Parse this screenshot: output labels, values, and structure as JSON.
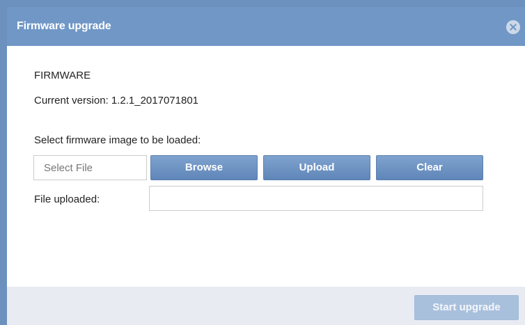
{
  "dialog": {
    "title": "Firmware upgrade",
    "close_icon": "close-circle-icon"
  },
  "firmware": {
    "section_title": "FIRMWARE",
    "current_version": "Current version: 1.2.1_2017071801"
  },
  "upload": {
    "select_label": "Select firmware image to be loaded:",
    "file_placeholder": "Select File",
    "browse_label": "Browse",
    "upload_label": "Upload",
    "clear_label": "Clear",
    "uploaded_label": "File uploaded:",
    "uploaded_value": ""
  },
  "footer": {
    "start_label": "Start upgrade",
    "start_enabled": false
  },
  "colors": {
    "titlebar": "#7097c6",
    "button": "#6d93c4",
    "button_disabled": "#a9c0dd",
    "footer": "#e8ebf2"
  }
}
